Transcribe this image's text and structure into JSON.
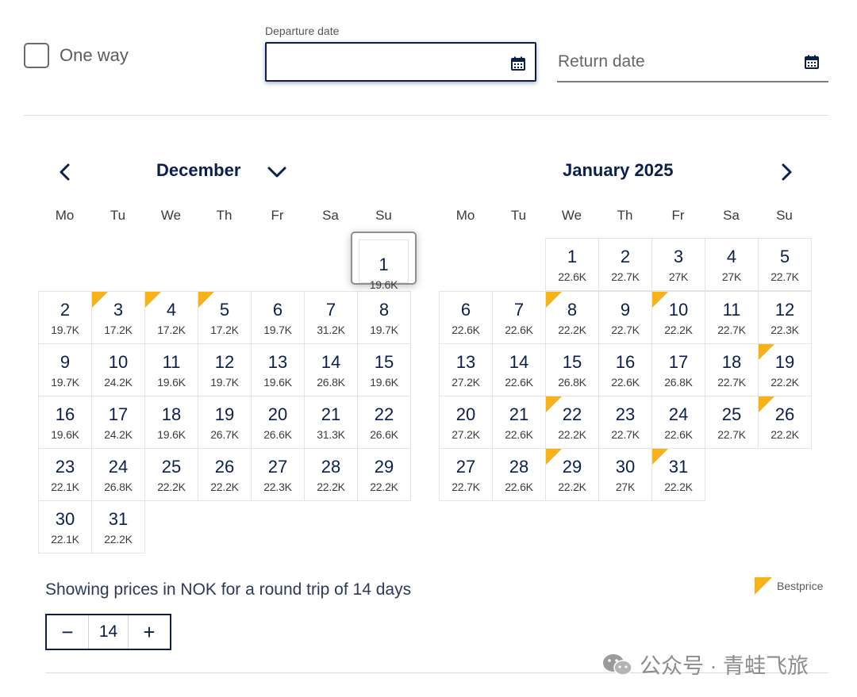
{
  "one_way": {
    "label": "One way"
  },
  "departure": {
    "label": "Departure date",
    "value": ""
  },
  "return": {
    "placeholder": "Return date"
  },
  "months": [
    {
      "title": "December",
      "weekdays": [
        "Mo",
        "Tu",
        "We",
        "Th",
        "Fr",
        "Sa",
        "Su"
      ],
      "offset": 6,
      "days": [
        {
          "d": "1",
          "p": "19.6K",
          "best": false,
          "selected": true
        },
        {
          "d": "2",
          "p": "19.7K",
          "best": false
        },
        {
          "d": "3",
          "p": "17.2K",
          "best": true
        },
        {
          "d": "4",
          "p": "17.2K",
          "best": true
        },
        {
          "d": "5",
          "p": "17.2K",
          "best": true
        },
        {
          "d": "6",
          "p": "19.7K",
          "best": false
        },
        {
          "d": "7",
          "p": "31.2K",
          "best": false
        },
        {
          "d": "8",
          "p": "19.7K",
          "best": false
        },
        {
          "d": "9",
          "p": "19.7K",
          "best": false
        },
        {
          "d": "10",
          "p": "24.2K",
          "best": false
        },
        {
          "d": "11",
          "p": "19.6K",
          "best": false
        },
        {
          "d": "12",
          "p": "19.7K",
          "best": false
        },
        {
          "d": "13",
          "p": "19.6K",
          "best": false
        },
        {
          "d": "14",
          "p": "26.8K",
          "best": false
        },
        {
          "d": "15",
          "p": "19.6K",
          "best": false
        },
        {
          "d": "16",
          "p": "19.6K",
          "best": false
        },
        {
          "d": "17",
          "p": "24.2K",
          "best": false
        },
        {
          "d": "18",
          "p": "19.6K",
          "best": false
        },
        {
          "d": "19",
          "p": "26.7K",
          "best": false
        },
        {
          "d": "20",
          "p": "26.6K",
          "best": false
        },
        {
          "d": "21",
          "p": "31.3K",
          "best": false
        },
        {
          "d": "22",
          "p": "26.6K",
          "best": false
        },
        {
          "d": "23",
          "p": "22.1K",
          "best": false
        },
        {
          "d": "24",
          "p": "26.8K",
          "best": false
        },
        {
          "d": "25",
          "p": "22.2K",
          "best": false
        },
        {
          "d": "26",
          "p": "22.2K",
          "best": false
        },
        {
          "d": "27",
          "p": "22.3K",
          "best": false
        },
        {
          "d": "28",
          "p": "22.2K",
          "best": false
        },
        {
          "d": "29",
          "p": "22.2K",
          "best": false
        },
        {
          "d": "30",
          "p": "22.1K",
          "best": false
        },
        {
          "d": "31",
          "p": "22.2K",
          "best": false
        }
      ]
    },
    {
      "title": "January 2025",
      "weekdays": [
        "Mo",
        "Tu",
        "We",
        "Th",
        "Fr",
        "Sa",
        "Su"
      ],
      "offset": 2,
      "days": [
        {
          "d": "1",
          "p": "22.6K",
          "best": false
        },
        {
          "d": "2",
          "p": "22.7K",
          "best": false
        },
        {
          "d": "3",
          "p": "27K",
          "best": false
        },
        {
          "d": "4",
          "p": "27K",
          "best": false
        },
        {
          "d": "5",
          "p": "22.7K",
          "best": false
        },
        {
          "d": "6",
          "p": "22.6K",
          "best": false
        },
        {
          "d": "7",
          "p": "22.6K",
          "best": false
        },
        {
          "d": "8",
          "p": "22.2K",
          "best": true
        },
        {
          "d": "9",
          "p": "22.7K",
          "best": false
        },
        {
          "d": "10",
          "p": "22.2K",
          "best": true
        },
        {
          "d": "11",
          "p": "22.7K",
          "best": false
        },
        {
          "d": "12",
          "p": "22.3K",
          "best": false
        },
        {
          "d": "13",
          "p": "27.2K",
          "best": false
        },
        {
          "d": "14",
          "p": "22.6K",
          "best": false
        },
        {
          "d": "15",
          "p": "26.8K",
          "best": false
        },
        {
          "d": "16",
          "p": "22.6K",
          "best": false
        },
        {
          "d": "17",
          "p": "26.8K",
          "best": false
        },
        {
          "d": "18",
          "p": "22.7K",
          "best": false
        },
        {
          "d": "19",
          "p": "22.2K",
          "best": true
        },
        {
          "d": "20",
          "p": "27.2K",
          "best": false
        },
        {
          "d": "21",
          "p": "22.6K",
          "best": false
        },
        {
          "d": "22",
          "p": "22.2K",
          "best": true
        },
        {
          "d": "23",
          "p": "22.7K",
          "best": false
        },
        {
          "d": "24",
          "p": "22.6K",
          "best": false
        },
        {
          "d": "25",
          "p": "22.7K",
          "best": false
        },
        {
          "d": "26",
          "p": "22.2K",
          "best": true
        },
        {
          "d": "27",
          "p": "22.7K",
          "best": false
        },
        {
          "d": "28",
          "p": "22.6K",
          "best": false
        },
        {
          "d": "29",
          "p": "22.2K",
          "best": true
        },
        {
          "d": "30",
          "p": "27K",
          "best": false
        },
        {
          "d": "31",
          "p": "22.2K",
          "best": true
        }
      ]
    }
  ],
  "note": "Showing prices in NOK for a round trip of 14 days",
  "legend": {
    "label": "Bestprice",
    "color": "#f7b217"
  },
  "stepper": {
    "minus": "−",
    "value": "14",
    "plus": "+"
  },
  "watermark": "公众号 · 青蛙飞旅",
  "icons": {
    "prev": "chevron-left-icon",
    "next": "chevron-right-icon",
    "dropdown": "chevron-down-icon",
    "calendar": "calendar-icon",
    "watermark": "wechat-icon"
  },
  "colors": {
    "navy": "#0b1f4d",
    "best": "#f7b217"
  }
}
